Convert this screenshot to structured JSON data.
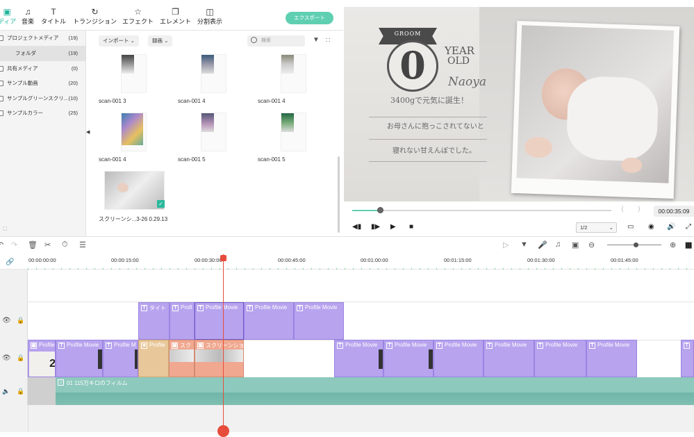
{
  "toolbar": {
    "tabs": [
      {
        "label": "ディア",
        "icon": "media-icon"
      },
      {
        "label": "音楽",
        "icon": "music-icon"
      },
      {
        "label": "タイトル",
        "icon": "title-icon"
      },
      {
        "label": "トランジション",
        "icon": "transition-icon"
      },
      {
        "label": "エフェクト",
        "icon": "effect-icon"
      },
      {
        "label": "エレメント",
        "icon": "element-icon"
      },
      {
        "label": "分割表示",
        "icon": "split-screen-icon"
      }
    ],
    "export_label": "エクスポート"
  },
  "sidebar": {
    "items": [
      {
        "label": "プロジェクトメディア",
        "count": "(19)"
      },
      {
        "label": "フォルダ",
        "count": "(19)"
      },
      {
        "label": "共有メディア",
        "count": "(0)"
      },
      {
        "label": "サンプル動画",
        "count": "(20)"
      },
      {
        "label": "サンプルグリーンスクリ...",
        "count": "(10)"
      },
      {
        "label": "サンプルカラー",
        "count": "(25)"
      }
    ]
  },
  "media": {
    "import_label": "インポート",
    "record_label": "録画",
    "search_placeholder": "検索",
    "items": [
      {
        "name": "scan-001 3"
      },
      {
        "name": "scan-001 4"
      },
      {
        "name": "scan-001 4"
      },
      {
        "name": "scan-001 4"
      },
      {
        "name": "scan-001 5"
      },
      {
        "name": "scan-001 5"
      },
      {
        "name": "スクリーンシ...3-26 0.29.13"
      }
    ]
  },
  "preview": {
    "groom": "GROOM",
    "age": "0",
    "year": "YEAR",
    "old": "OLD",
    "name": "Naoya",
    "line1": "3400gで元気に誕生！",
    "line2": "お母さんに抱っこされてないと",
    "line3": "寝れない甘えんぼでした。",
    "progress": 0.09,
    "timecode": "00:00:35:09",
    "quality": "1/2"
  },
  "ruler": {
    "ticks": [
      "00:00:00:00",
      "00:00:15:00",
      "00:00:30:00",
      "00:00:45:00",
      "00:01:00:00",
      "00:01:15:00",
      "00:01:30:00",
      "00:01:45:00"
    ]
  },
  "tracks": {
    "title_clips": [
      "タイト",
      "Profi",
      "Profile Movie",
      "Profile Movie",
      "Profile Movie"
    ],
    "video_clips": [
      "Profile",
      "Profile Movie",
      "Profile M",
      "Profile",
      "スク",
      "スクリーンショ",
      "Profile Movie",
      "Profile Movie",
      "Profile Movie",
      "Profile Movie",
      "Profile Movie",
      "Profile Movie"
    ],
    "audio_clip": "01 115万キロのフィルム"
  }
}
